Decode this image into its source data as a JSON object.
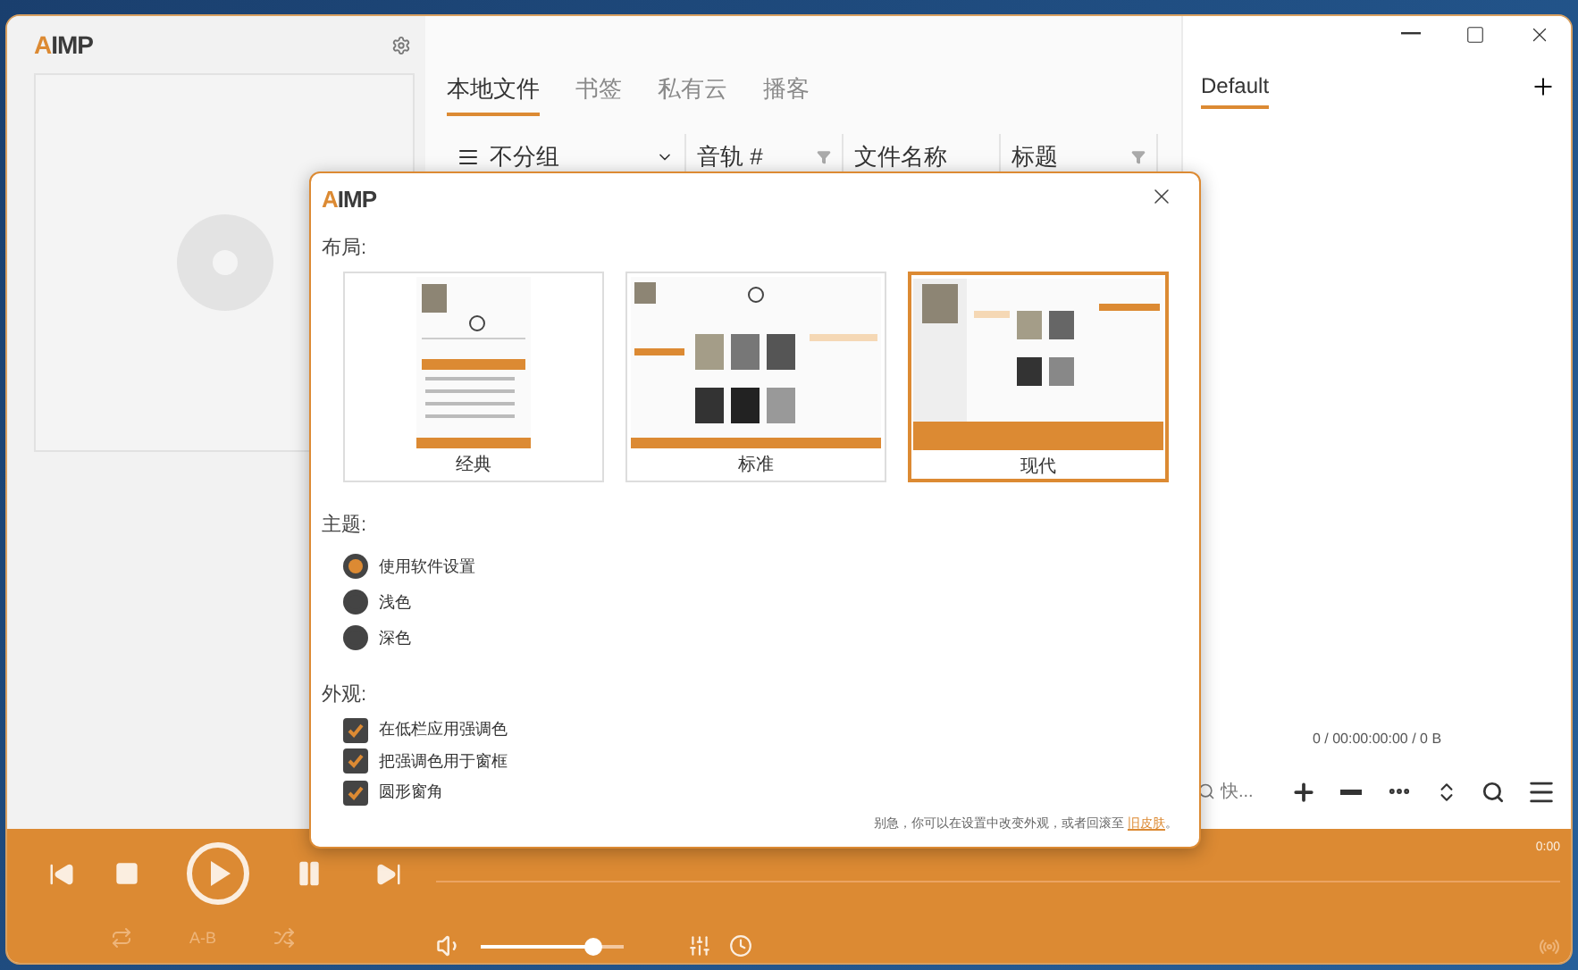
{
  "app": {
    "logo": "AIMP"
  },
  "library_tabs": [
    {
      "label": "本地文件",
      "selected": true
    },
    {
      "label": "书签",
      "selected": false
    },
    {
      "label": "私有云",
      "selected": false
    },
    {
      "label": "播客",
      "selected": false
    }
  ],
  "library_columns": [
    {
      "label": "不分组",
      "kind": "group"
    },
    {
      "label": "音轨 #",
      "kind": "filter"
    },
    {
      "label": "文件名称",
      "kind": "plain"
    },
    {
      "label": "标题",
      "kind": "filter"
    }
  ],
  "playlist_tabs": [
    {
      "label": "Default",
      "selected": true
    }
  ],
  "playlist_status": "0 / 00:00:00:00 / 0 B",
  "quick_search": {
    "placeholder": "快..."
  },
  "player": {
    "time_elapsed": "0:00",
    "ab_label": "A-B"
  },
  "dialog": {
    "logo": "AIMP",
    "layout_heading": "布局:",
    "layouts": [
      {
        "label": "经典",
        "kind": "classic",
        "selected": false
      },
      {
        "label": "标准",
        "kind": "standard",
        "selected": false
      },
      {
        "label": "现代",
        "kind": "modern",
        "selected": true
      }
    ],
    "theme_heading": "主题:",
    "themes": [
      {
        "label": "使用软件设置",
        "selected": true
      },
      {
        "label": "浅色",
        "selected": false
      },
      {
        "label": "深色",
        "selected": false
      }
    ],
    "appearance_heading": "外观:",
    "options": [
      {
        "label": "在低栏应用强调色",
        "checked": true
      },
      {
        "label": "把强调色用于窗框",
        "checked": true
      },
      {
        "label": "圆形窗角",
        "checked": true
      }
    ],
    "footer_text": "别急，你可以在设置中改变外观，或者回滚至",
    "footer_link": "旧皮肤",
    "footer_end": "。"
  }
}
